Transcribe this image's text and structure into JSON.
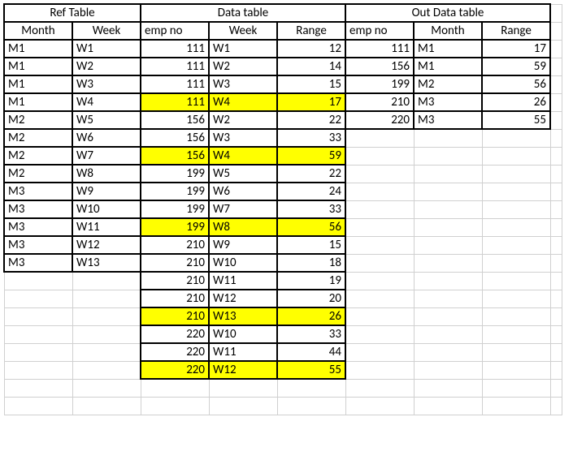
{
  "titles": {
    "ref": "Ref Table",
    "data": "Data table",
    "out": "Out Data table"
  },
  "headers": {
    "month": "Month",
    "week": "Week",
    "emp": "emp no",
    "range": "Range"
  },
  "ref": [
    {
      "month": "M1",
      "week": "W1"
    },
    {
      "month": "M1",
      "week": "W2"
    },
    {
      "month": "M1",
      "week": "W3"
    },
    {
      "month": "M1",
      "week": "W4"
    },
    {
      "month": "M2",
      "week": "W5"
    },
    {
      "month": "M2",
      "week": "W6"
    },
    {
      "month": "M2",
      "week": "W7"
    },
    {
      "month": "M2",
      "week": "W8"
    },
    {
      "month": "M3",
      "week": "W9"
    },
    {
      "month": "M3",
      "week": "W10"
    },
    {
      "month": "M3",
      "week": "W11"
    },
    {
      "month": "M3",
      "week": "W12"
    },
    {
      "month": "M3",
      "week": "W13"
    }
  ],
  "data": [
    {
      "emp": "111",
      "week": "W1",
      "range": "12",
      "hl": false
    },
    {
      "emp": "111",
      "week": "W2",
      "range": "14",
      "hl": false
    },
    {
      "emp": "111",
      "week": "W3",
      "range": "15",
      "hl": false
    },
    {
      "emp": "111",
      "week": "W4",
      "range": "17",
      "hl": true
    },
    {
      "emp": "156",
      "week": "W2",
      "range": "22",
      "hl": false
    },
    {
      "emp": "156",
      "week": "W3",
      "range": "33",
      "hl": false
    },
    {
      "emp": "156",
      "week": "W4",
      "range": "59",
      "hl": true
    },
    {
      "emp": "199",
      "week": "W5",
      "range": "22",
      "hl": false
    },
    {
      "emp": "199",
      "week": "W6",
      "range": "24",
      "hl": false
    },
    {
      "emp": "199",
      "week": "W7",
      "range": "33",
      "hl": false
    },
    {
      "emp": "199",
      "week": "W8",
      "range": "56",
      "hl": true
    },
    {
      "emp": "210",
      "week": "W9",
      "range": "15",
      "hl": false
    },
    {
      "emp": "210",
      "week": "W10",
      "range": "18",
      "hl": false
    },
    {
      "emp": "210",
      "week": "W11",
      "range": "19",
      "hl": false
    },
    {
      "emp": "210",
      "week": "W12",
      "range": "20",
      "hl": false
    },
    {
      "emp": "210",
      "week": "W13",
      "range": "26",
      "hl": true
    },
    {
      "emp": "220",
      "week": "W10",
      "range": "33",
      "hl": false
    },
    {
      "emp": "220",
      "week": "W11",
      "range": "44",
      "hl": false
    },
    {
      "emp": "220",
      "week": "W12",
      "range": "55",
      "hl": true
    }
  ],
  "out": [
    {
      "emp": "111",
      "month": "M1",
      "range": "17"
    },
    {
      "emp": "156",
      "month": "M1",
      "range": "59"
    },
    {
      "emp": "199",
      "month": "M2",
      "range": "56"
    },
    {
      "emp": "210",
      "month": "M3",
      "range": "26"
    },
    {
      "emp": "220",
      "month": "M3",
      "range": "55"
    }
  ]
}
